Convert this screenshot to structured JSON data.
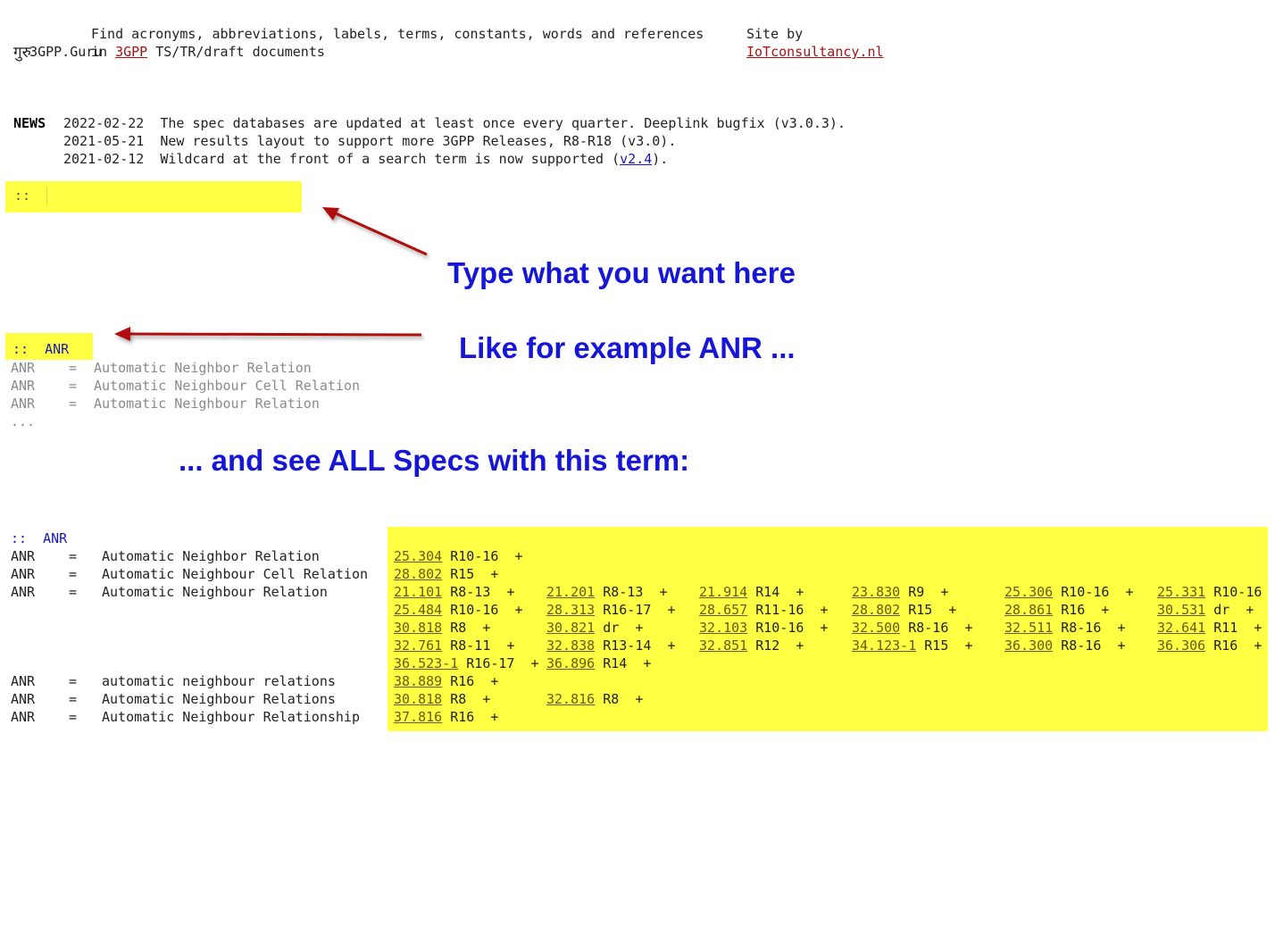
{
  "header": {
    "logo": "3GPP.Guru",
    "logo_hindi": "गुरु",
    "tagline_line1": "Find acronyms, abbreviations, labels, terms, constants, words and references",
    "tagline_in": "in ",
    "tagline_link": "3GPP",
    "tagline_rest": " TS/TR/draft documents",
    "site_by": "Site by",
    "site_link": "IoTconsultancy.nl"
  },
  "news": {
    "label": "NEWS",
    "items": [
      {
        "date": "2022-02-22",
        "text": "The spec databases are updated at least once every quarter. Deeplink bugfix (v3.0.3)."
      },
      {
        "date": "2021-05-21",
        "text": "New results layout to support more 3GPP Releases, R8-R18 (v3.0)."
      },
      {
        "date": "2021-02-12",
        "text_before": "Wildcard at the front of a search term is now supported (",
        "link": "v2.4",
        "text_after": ")."
      }
    ]
  },
  "search": {
    "prompt": "::",
    "value": ""
  },
  "callouts": {
    "type_here": "Type what you want here",
    "example": "Like for example ANR ...",
    "see_all": "... and see ALL Specs with this term:"
  },
  "example_search": {
    "prompt": "::",
    "value": "ANR",
    "suggestions": [
      {
        "abbr": "ANR",
        "eq": "=",
        "expansion": "Automatic Neighbor Relation"
      },
      {
        "abbr": "ANR",
        "eq": "=",
        "expansion": "Automatic Neighbour Cell Relation"
      },
      {
        "abbr": "ANR",
        "eq": "=",
        "expansion": "Automatic Neighbour Relation"
      }
    ],
    "more": "..."
  },
  "results": {
    "prompt": "::",
    "query": "ANR",
    "rows": [
      {
        "abbr": "ANR",
        "eq": "=",
        "expansion": "Automatic Neighbor Relation",
        "specs": [
          {
            "num": "25.304",
            "rel": "R10-16",
            "plus": "+"
          }
        ]
      },
      {
        "abbr": "ANR",
        "eq": "=",
        "expansion": "Automatic Neighbour Cell Relation",
        "specs": [
          {
            "num": "28.802",
            "rel": "R15",
            "plus": "+"
          }
        ]
      },
      {
        "abbr": "ANR",
        "eq": "=",
        "expansion": "Automatic Neighbour Relation",
        "specs": [
          {
            "num": "21.101",
            "rel": "R8-13",
            "plus": "+"
          },
          {
            "num": "21.201",
            "rel": "R8-13",
            "plus": "+"
          },
          {
            "num": "21.914",
            "rel": "R14",
            "plus": "+"
          },
          {
            "num": "23.830",
            "rel": "R9",
            "plus": "+"
          },
          {
            "num": "25.306",
            "rel": "R10-16",
            "plus": "+"
          },
          {
            "num": "25.331",
            "rel": "R10-16",
            "plus": "+"
          },
          {
            "num": "25.484",
            "rel": "R10-16",
            "plus": "+"
          },
          {
            "num": "28.313",
            "rel": "R16-17",
            "plus": "+"
          },
          {
            "num": "28.657",
            "rel": "R11-16",
            "plus": "+"
          },
          {
            "num": "28.802",
            "rel": "R15",
            "plus": "+"
          },
          {
            "num": "28.861",
            "rel": "R16",
            "plus": "+"
          },
          {
            "num": "30.531",
            "rel": "dr",
            "plus": "+"
          },
          {
            "num": "30.818",
            "rel": "R8",
            "plus": "+"
          },
          {
            "num": "30.821",
            "rel": "dr",
            "plus": "+"
          },
          {
            "num": "32.103",
            "rel": "R10-16",
            "plus": "+"
          },
          {
            "num": "32.500",
            "rel": "R8-16",
            "plus": "+"
          },
          {
            "num": "32.511",
            "rel": "R8-16",
            "plus": "+"
          },
          {
            "num": "32.641",
            "rel": "R11",
            "plus": "+"
          },
          {
            "num": "32.761",
            "rel": "R8-11",
            "plus": "+"
          },
          {
            "num": "32.838",
            "rel": "R13-14",
            "plus": "+"
          },
          {
            "num": "32.851",
            "rel": "R12",
            "plus": "+"
          },
          {
            "num": "34.123-1",
            "rel": "R15",
            "plus": "+"
          },
          {
            "num": "36.300",
            "rel": "R8-16",
            "plus": "+"
          },
          {
            "num": "36.306",
            "rel": "R16",
            "plus": "+"
          },
          {
            "num": "36.523-1",
            "rel": "R16-17",
            "plus": "+"
          },
          {
            "num": "36.896",
            "rel": "R14",
            "plus": "+"
          }
        ]
      },
      {
        "abbr": "ANR",
        "eq": "=",
        "expansion": "automatic neighbour relations",
        "specs": [
          {
            "num": "38.889",
            "rel": "R16",
            "plus": "+"
          }
        ]
      },
      {
        "abbr": "ANR",
        "eq": "=",
        "expansion": "Automatic Neighbour Relations",
        "specs": [
          {
            "num": "30.818",
            "rel": "R8",
            "plus": "+"
          },
          {
            "num": "32.816",
            "rel": "R8",
            "plus": "+"
          }
        ]
      },
      {
        "abbr": "ANR",
        "eq": "=",
        "expansion": "Automatic Neighbour Relationship",
        "specs": [
          {
            "num": "37.816",
            "rel": "R16",
            "plus": "+"
          }
        ]
      }
    ]
  },
  "colors": {
    "highlight": "#ffff44",
    "callout": "#1616d8",
    "arrow": "#b01010",
    "link": "#a31515",
    "spec_link": "#6b5a00"
  }
}
